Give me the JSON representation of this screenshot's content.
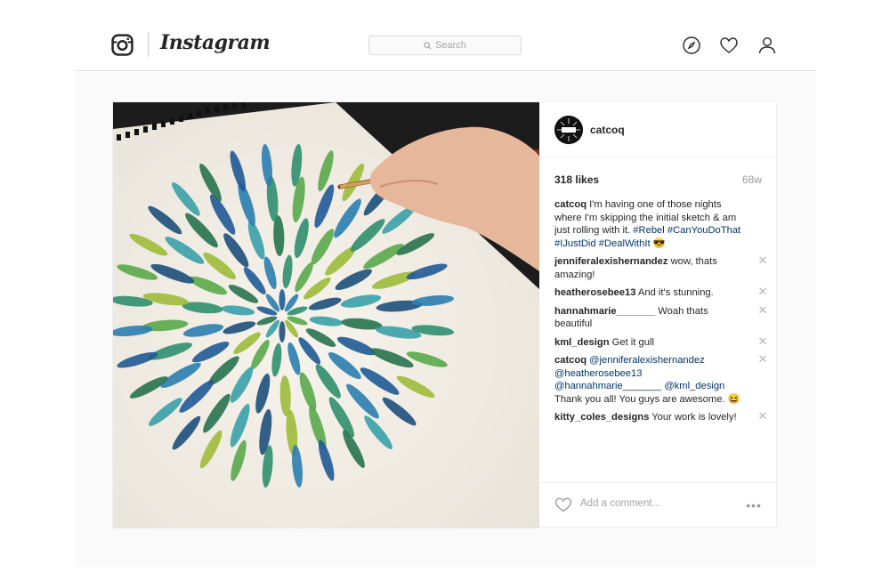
{
  "header": {
    "brand": "Instagram",
    "search_placeholder": "Search",
    "icons": [
      "instagram-glyph-icon",
      "search-icon",
      "compass-icon",
      "heart-icon",
      "profile-icon"
    ]
  },
  "post": {
    "owner": "catcoq",
    "likes": "318 likes",
    "age": "68w",
    "comments": [
      {
        "user": "catcoq",
        "parts": [
          {
            "t": " I'm having one of those nights where I'm skipping the initial sketch & am just rolling with it. ",
            "tag": false
          },
          {
            "t": "#Rebel #CanYouDoThat #IJustDid #DealWithIt",
            "tag": true
          },
          {
            "t": " 😎",
            "tag": false
          }
        ],
        "deletable": false
      },
      {
        "user": "jenniferalexishernandez",
        "parts": [
          {
            "t": " wow, thats amazing!",
            "tag": false
          }
        ],
        "deletable": true
      },
      {
        "user": "heatherosebee13",
        "parts": [
          {
            "t": " And it's stunning.",
            "tag": false
          }
        ],
        "deletable": true
      },
      {
        "user": "hannahmarie_______",
        "parts": [
          {
            "t": " Woah thats beautiful",
            "tag": false
          }
        ],
        "deletable": true
      },
      {
        "user": "kml_design",
        "parts": [
          {
            "t": " Get it gull",
            "tag": false
          }
        ],
        "deletable": true
      },
      {
        "user": "catcoq",
        "parts": [
          {
            "t": " @jenniferalexishernandez @heatherosebee13 @hannahmarie_______ @kml_design",
            "tag": true
          },
          {
            "t": " Thank you all! You guys are awesome. 😆",
            "tag": false
          }
        ],
        "deletable": true
      },
      {
        "user": "kitty_coles_designs",
        "parts": [
          {
            "t": " Your work is lovely!",
            "tag": false
          }
        ],
        "deletable": true
      }
    ],
    "add_comment_placeholder": "Add a comment...",
    "more_label": "•••",
    "delete_glyph": "✕"
  },
  "colors": {
    "text": "#262626",
    "link": "#003569",
    "muted": "#999999",
    "border": "#dbdbdb",
    "stage_bg": "#fafafa"
  }
}
